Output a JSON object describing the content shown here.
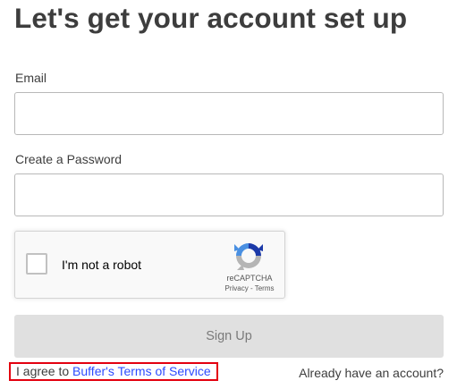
{
  "page": {
    "title": "Let's get your account set up"
  },
  "form": {
    "email_label": "Email",
    "email_value": "",
    "password_label": "Create a Password",
    "password_value": "",
    "signup_label": "Sign Up"
  },
  "recaptcha": {
    "label": "I'm not a robot",
    "brand": "reCAPTCHA",
    "privacy_link": "Privacy",
    "separator": " - ",
    "terms_link": "Terms",
    "checked": false,
    "logo_icon": "recaptcha-logo-icon"
  },
  "footer": {
    "terms_prefix": "I agree to ",
    "terms_link": "Buffer's Terms of Service",
    "login_link": "Already have an account?"
  },
  "colors": {
    "link": "#2c4bff",
    "highlight": "#e3000f",
    "button_bg": "#e0e0e0",
    "text": "#3d3d3d"
  }
}
